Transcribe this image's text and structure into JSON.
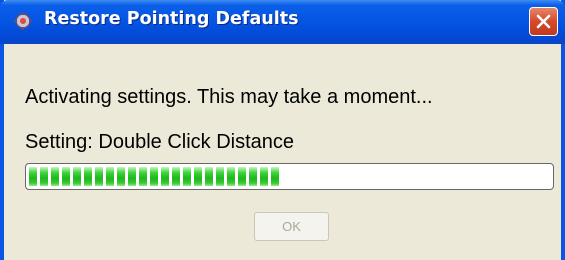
{
  "window": {
    "title": "Restore Pointing Defaults",
    "title_icon": "mouse-settings-icon",
    "close_icon": "close-icon"
  },
  "dialog": {
    "message": "Activating settings. This may take a moment...",
    "current_setting": "Setting: Double Click Distance",
    "progress_fraction": 0.48,
    "ok_label": "OK",
    "ok_enabled": false
  },
  "colors": {
    "titlebar": "#0554e3",
    "close_button": "#d4492a",
    "progress": "#22b51f",
    "window_bg": "#ece9d8"
  }
}
